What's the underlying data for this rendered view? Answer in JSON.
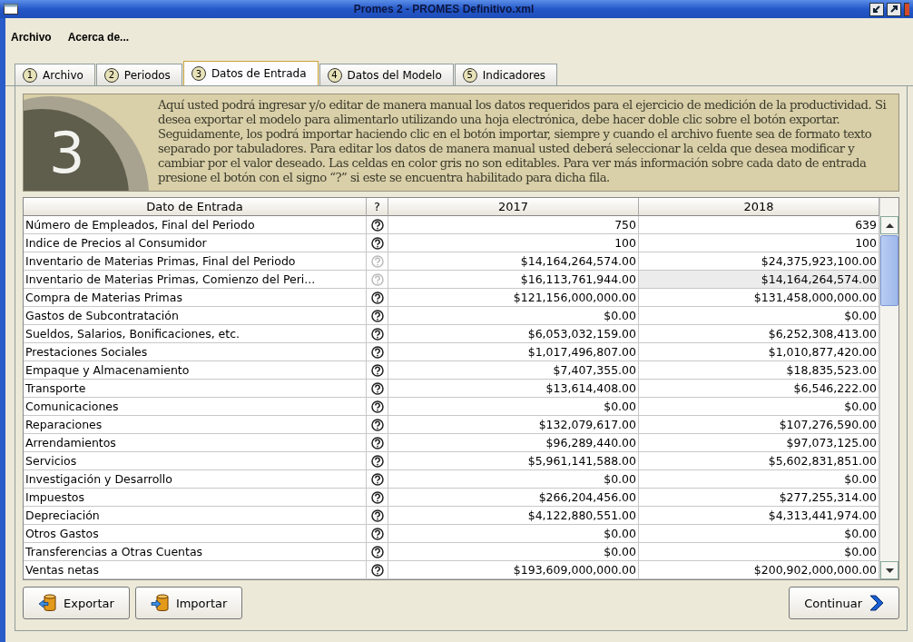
{
  "window": {
    "title": "Promes 2 - PROMES Definitivo.xml"
  },
  "menu": [
    "Archivo",
    "Acerca de..."
  ],
  "tabs": [
    {
      "number": "1",
      "label": "Archivo",
      "selected": false
    },
    {
      "number": "2",
      "label": "Periodos",
      "selected": false
    },
    {
      "number": "3",
      "label": "Datos de Entrada",
      "selected": true
    },
    {
      "number": "4",
      "label": "Datos del Modelo",
      "selected": false
    },
    {
      "number": "5",
      "label": "Indicadores",
      "selected": false
    }
  ],
  "info": {
    "step": "3",
    "text": "Aquí usted podrá ingresar y/o editar de manera manual los datos requeridos para el ejercicio de medición de la productividad. Si desea exportar el modelo para alimentarlo utilizando una hoja electrónica, debe hacer doble clic sobre el botón exportar. Seguidamente, los podrá importar haciendo clic en el botón importar, siempre y cuando el archivo fuente sea de formato texto separado por tabuladores. Para editar los datos de manera manual usted deberá seleccionar la celda que desea modificar y cambiar por el valor deseado. Las celdas en color gris no son editables. Para ver más información sobre cada dato de entrada presione el botón con el signo “?” si este se encuentra habilitado para dicha fila."
  },
  "table": {
    "columns": [
      "Dato de Entrada",
      "?",
      "2017",
      "2018"
    ],
    "rows": [
      {
        "label": "Número de Empleados, Final del Periodo",
        "help_enabled": true,
        "values": [
          {
            "text": "750",
            "grey": false
          },
          {
            "text": "639",
            "grey": false
          }
        ]
      },
      {
        "label": "Indice de Precios al Consumidor",
        "help_enabled": true,
        "values": [
          {
            "text": "100",
            "grey": false
          },
          {
            "text": "100",
            "grey": false
          }
        ]
      },
      {
        "label": "Inventario de Materias Primas,  Final del Periodo",
        "help_enabled": false,
        "values": [
          {
            "text": "$14,164,264,574.00",
            "grey": false
          },
          {
            "text": "$24,375,923,100.00",
            "grey": false
          }
        ]
      },
      {
        "label": "Inventario de Materias Primas, Comienzo del Peri...",
        "help_enabled": false,
        "values": [
          {
            "text": "$16,113,761,944.00",
            "grey": false
          },
          {
            "text": "$14,164,264,574.00",
            "grey": true
          }
        ]
      },
      {
        "label": "Compra de Materias Primas",
        "help_enabled": true,
        "values": [
          {
            "text": "$121,156,000,000.00",
            "grey": false
          },
          {
            "text": "$131,458,000,000.00",
            "grey": false
          }
        ]
      },
      {
        "label": "Gastos de Subcontratación",
        "help_enabled": true,
        "values": [
          {
            "text": "$0.00",
            "grey": false
          },
          {
            "text": "$0.00",
            "grey": false
          }
        ]
      },
      {
        "label": "Sueldos, Salarios, Bonificaciones, etc.",
        "help_enabled": true,
        "values": [
          {
            "text": "$6,053,032,159.00",
            "grey": false
          },
          {
            "text": "$6,252,308,413.00",
            "grey": false
          }
        ]
      },
      {
        "label": "Prestaciones Sociales",
        "help_enabled": true,
        "values": [
          {
            "text": "$1,017,496,807.00",
            "grey": false
          },
          {
            "text": "$1,010,877,420.00",
            "grey": false
          }
        ]
      },
      {
        "label": "Empaque y Almacenamiento",
        "help_enabled": true,
        "values": [
          {
            "text": "$7,407,355.00",
            "grey": false
          },
          {
            "text": "$18,835,523.00",
            "grey": false
          }
        ]
      },
      {
        "label": "Transporte",
        "help_enabled": true,
        "values": [
          {
            "text": "$13,614,408.00",
            "grey": false
          },
          {
            "text": "$6,546,222.00",
            "grey": false
          }
        ]
      },
      {
        "label": "Comunicaciones",
        "help_enabled": true,
        "values": [
          {
            "text": "$0.00",
            "grey": false
          },
          {
            "text": "$0.00",
            "grey": false
          }
        ]
      },
      {
        "label": "Reparaciones",
        "help_enabled": true,
        "values": [
          {
            "text": "$132,079,617.00",
            "grey": false
          },
          {
            "text": "$107,276,590.00",
            "grey": false
          }
        ]
      },
      {
        "label": "Arrendamientos",
        "help_enabled": true,
        "values": [
          {
            "text": "$96,289,440.00",
            "grey": false
          },
          {
            "text": "$97,073,125.00",
            "grey": false
          }
        ]
      },
      {
        "label": "Servicios",
        "help_enabled": true,
        "values": [
          {
            "text": "$5,961,141,588.00",
            "grey": false
          },
          {
            "text": "$5,602,831,851.00",
            "grey": false
          }
        ]
      },
      {
        "label": "Investigación y Desarrollo",
        "help_enabled": true,
        "values": [
          {
            "text": "$0.00",
            "grey": false
          },
          {
            "text": "$0.00",
            "grey": false
          }
        ]
      },
      {
        "label": "Impuestos",
        "help_enabled": true,
        "values": [
          {
            "text": "$266,204,456.00",
            "grey": false
          },
          {
            "text": "$277,255,314.00",
            "grey": false
          }
        ]
      },
      {
        "label": "Depreciación",
        "help_enabled": true,
        "values": [
          {
            "text": "$4,122,880,551.00",
            "grey": false
          },
          {
            "text": "$4,313,441,974.00",
            "grey": false
          }
        ]
      },
      {
        "label": "Otros Gastos",
        "help_enabled": true,
        "values": [
          {
            "text": "$0.00",
            "grey": false
          },
          {
            "text": "$0.00",
            "grey": false
          }
        ]
      },
      {
        "label": "Transferencias a Otras Cuentas",
        "help_enabled": true,
        "values": [
          {
            "text": "$0.00",
            "grey": false
          },
          {
            "text": "$0.00",
            "grey": false
          }
        ]
      },
      {
        "label": "Ventas netas",
        "help_enabled": true,
        "values": [
          {
            "text": "$193,609,000,000.00",
            "grey": false
          },
          {
            "text": "$200,902,000,000.00",
            "grey": false
          }
        ]
      }
    ]
  },
  "buttons": [
    {
      "kind": "export",
      "label": "Exportar"
    },
    {
      "kind": "import",
      "label": "Importar"
    },
    {
      "kind": "continue",
      "label": "Continuar"
    }
  ]
}
